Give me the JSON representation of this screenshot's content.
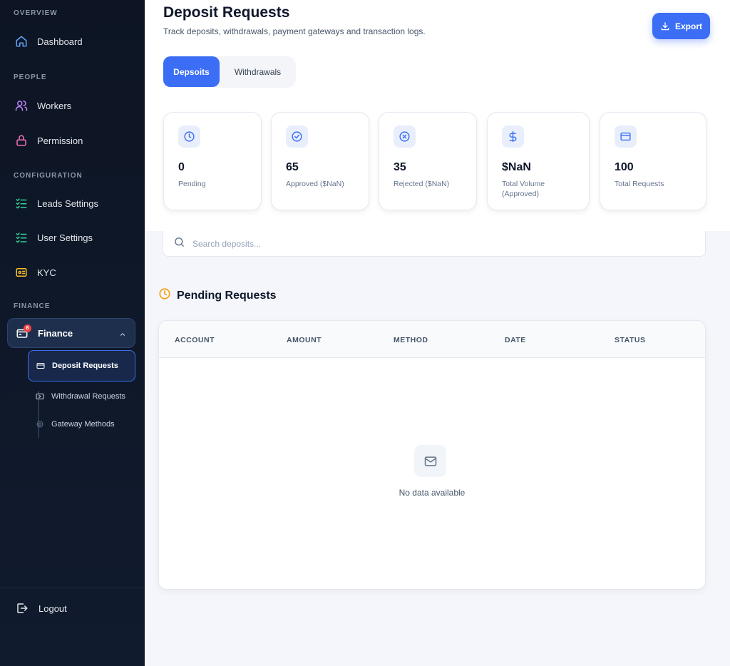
{
  "sidebar": {
    "sections": {
      "overview": "OVERVIEW",
      "people": "PEOPLE",
      "configuration": "CONFIGURATION",
      "finance": "FINANCE"
    },
    "items": {
      "dashboard": "Dashboard",
      "workers": "Workers",
      "permission": "Permission",
      "leads_settings": "Leads Settings",
      "user_settings": "User Settings",
      "kyc": "KYC",
      "finance": "Finance",
      "finance_badge": "8"
    },
    "finance_sub": {
      "deposit_requests": "Deposit Requests",
      "withdrawal_requests": "Withdrawal Requests",
      "gateway_methods": "Gateway Methods"
    },
    "logout": "Logout"
  },
  "header": {
    "title": "Deposit Requests",
    "subtitle": "Track deposits, withdrawals, payment gateways and transaction logs.",
    "export_label": "Export"
  },
  "tabs": {
    "deposits": "Depsoits",
    "withdrawals": "Withdrawals"
  },
  "stats": {
    "pending": {
      "value": "0",
      "label": "Pending"
    },
    "approved": {
      "value": "65",
      "label": "Approved ($NaN)"
    },
    "rejected": {
      "value": "35",
      "label": "Rejected ($NaN)"
    },
    "volume": {
      "value": "$NaN",
      "label": "Total Volume (Approved)"
    },
    "total": {
      "value": "100",
      "label": "Total Requests"
    }
  },
  "search": {
    "placeholder": "Search deposits..."
  },
  "pending_section": {
    "title": "Pending Requests",
    "columns": [
      "ACCOUNT",
      "AMOUNT",
      "METHOD",
      "DATE",
      "STATUS"
    ],
    "empty_text": "No data available"
  },
  "colors": {
    "accent": "#3b6ef5",
    "sidebar_bg": "#0d1524",
    "pending_clock": "#f59e0b",
    "badge": "#ef4444"
  }
}
